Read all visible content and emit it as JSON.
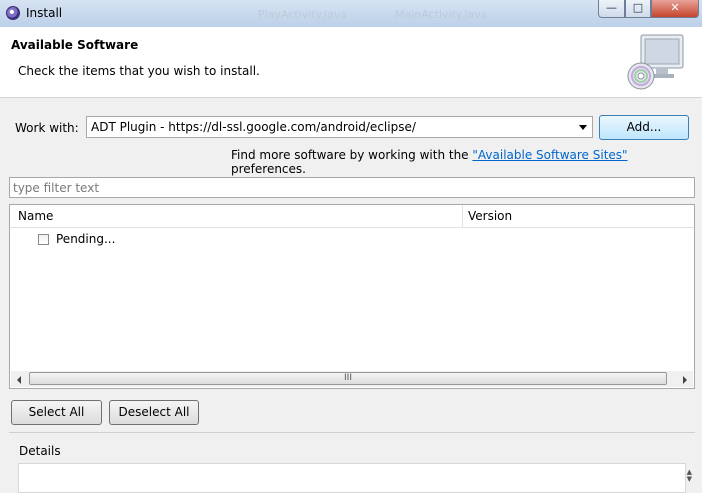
{
  "window": {
    "title": "Install",
    "background_tabs": [
      "PlayActivity.java",
      "MainActivity.java"
    ],
    "controls": {
      "minimize": "—",
      "maximize": "□",
      "close": "✕"
    }
  },
  "header": {
    "title": "Available Software",
    "description": "Check the items that you wish to install.",
    "icon": "software-cd-monitor-icon"
  },
  "work_with": {
    "label": "Work with:",
    "value": "ADT Plugin - https://dl-ssl.google.com/android/eclipse/",
    "add_label": "Add...",
    "find_more_prefix": "Find more software by working with the ",
    "find_more_link": "\"Available Software Sites\"",
    "find_more_suffix": " preferences."
  },
  "filter": {
    "placeholder": "type filter text"
  },
  "table": {
    "columns": [
      "Name",
      "Version"
    ],
    "rows": [
      {
        "label": "Pending...",
        "checked": false
      }
    ],
    "scroll_grip": "III"
  },
  "buttons": {
    "select_all": "Select All",
    "deselect_all": "Deselect All"
  },
  "details": {
    "label": "Details"
  },
  "colors": {
    "link": "#0066cc",
    "titlebar": "#c8d9ee",
    "close": "#c5442d"
  }
}
